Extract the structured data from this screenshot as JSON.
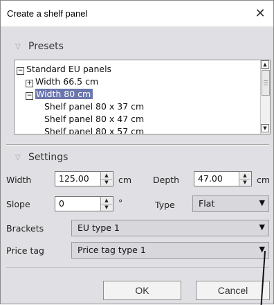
{
  "window": {
    "title": "Create a shelf panel"
  },
  "icons": {
    "close": "close-icon",
    "collapse": "triangle-down-icon"
  },
  "presets": {
    "heading": "Presets",
    "tree": [
      {
        "label": "Standard EU panels",
        "expander": "⊟",
        "level": 0,
        "selected": false
      },
      {
        "label": "Width 66.5 cm",
        "expander": "⊞",
        "level": 1,
        "selected": false
      },
      {
        "label": "Width 80 cm",
        "expander": "⊟",
        "level": 1,
        "selected": true
      },
      {
        "label": "Shelf panel 80 x 37 cm",
        "expander": "",
        "level": 2,
        "selected": false
      },
      {
        "label": "Shelf panel 80 x 47 cm",
        "expander": "",
        "level": 2,
        "selected": false
      },
      {
        "label": "Shelf panel 80 x 57 cm",
        "expander": "",
        "level": 2,
        "selected": false
      }
    ]
  },
  "settings": {
    "heading": "Settings",
    "width": {
      "label": "Width",
      "value": "125.00",
      "unit": "cm"
    },
    "depth": {
      "label": "Depth",
      "value": "47.00",
      "unit": "cm"
    },
    "slope": {
      "label": "Slope",
      "value": "0",
      "unit": "°"
    },
    "type": {
      "label": "Type",
      "value": "Flat"
    },
    "brackets": {
      "label": "Brackets",
      "value": "EU type 1"
    },
    "price_tag": {
      "label": "Price tag",
      "value": "Price tag type 1"
    }
  },
  "buttons": {
    "ok": "OK",
    "cancel": "Cancel"
  },
  "colors": {
    "selection": "#6b76ad",
    "dialog_bg": "#e0dfe3"
  }
}
